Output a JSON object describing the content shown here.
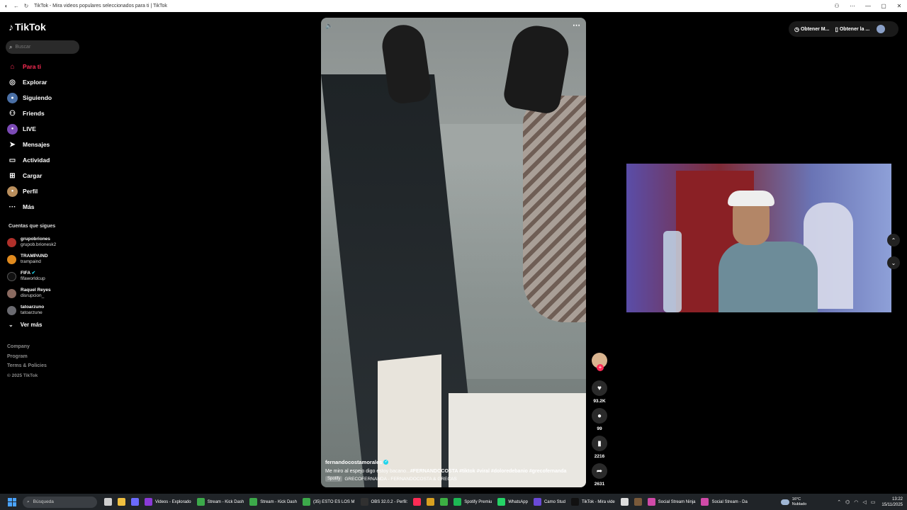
{
  "browser": {
    "tab_title": "TikTok - Mira videos populares seleccionados para ti | TikTok",
    "controls": [
      "minimize",
      "maximize",
      "close"
    ]
  },
  "sidebar": {
    "logo": "TikTok",
    "search_placeholder": "Buscar",
    "nav": [
      {
        "label": "Para ti",
        "icon": "home-icon",
        "active": true
      },
      {
        "label": "Explorar",
        "icon": "compass-icon"
      },
      {
        "label": "Siguiendo",
        "icon": "following-avatar-icon"
      },
      {
        "label": "Friends",
        "icon": "friends-icon"
      },
      {
        "label": "LIVE",
        "icon": "live-icon"
      },
      {
        "label": "Mensajes",
        "icon": "send-icon"
      },
      {
        "label": "Actividad",
        "icon": "inbox-icon"
      },
      {
        "label": "Cargar",
        "icon": "upload-icon"
      },
      {
        "label": "Perfil",
        "icon": "profile-avatar-icon"
      },
      {
        "label": "Más",
        "icon": "more-icon"
      }
    ],
    "following_header": "Cuentas que sigues",
    "following": [
      {
        "name": "grupobriones",
        "handle": "grupob.brionesk2",
        "color": "#b0302a"
      },
      {
        "name": "TRAMPAIND",
        "handle": "trampaind",
        "color": "#e08a1e"
      },
      {
        "name": "FIFA",
        "handle": "fifaworldcup",
        "color": "#111111",
        "verified": true
      },
      {
        "name": "Raquel Reyes",
        "handle": "disrupcion_",
        "color": "#8a6a60"
      },
      {
        "name": "tatoarzuno",
        "handle": "tatoarzune",
        "color": "#6a6a70"
      }
    ],
    "see_more": "Ver más",
    "footer": [
      "Company",
      "Program",
      "Terms & Policies"
    ],
    "copyright": "© 2025 TikTok"
  },
  "video": {
    "author": "fernandocostamorales",
    "description": "Me miro al espejo digo estoy bacano...",
    "tags": "#FERNANDOCOSTA  #tiktok  #viral  #doloredebanio  #grecofernanda",
    "music_badge": "Spotify",
    "music": "GRECOFERNANDA - FERNANDOCOSTA & GRECAS"
  },
  "actions": {
    "likes": "93.2K",
    "comments": "99",
    "saves": "2216",
    "shares": "2631"
  },
  "top_buttons": {
    "btn1": "Obtener M...",
    "btn2": "Obtener la ..."
  },
  "taskbar": {
    "search": "Búsqueda",
    "apps": [
      {
        "label": "",
        "color": "#cfcfcf"
      },
      {
        "label": "",
        "color": "#f0c040"
      },
      {
        "label": "",
        "color": "#6b6bff"
      },
      {
        "label": "Videos - Explorado",
        "color": "#8a3ad8"
      },
      {
        "label": "Stream - Kick Dash",
        "color": "#3ca94a"
      },
      {
        "label": "Stream - Kick Dash",
        "color": "#3ca94a"
      },
      {
        "label": "(35) ESTO ES LOS M",
        "color": "#3ca94a"
      },
      {
        "label": "OBS 32.0.2 - Perfil:",
        "color": "#303030"
      },
      {
        "label": "",
        "color": "#fe2c55"
      },
      {
        "label": "",
        "color": "#d8a020"
      },
      {
        "label": "",
        "color": "#3cb043"
      },
      {
        "label": "Spotify Premiu",
        "color": "#1db954"
      },
      {
        "label": "WhatsApp",
        "color": "#25d366"
      },
      {
        "label": "Camo Stud",
        "color": "#6a4ad8"
      },
      {
        "label": "TikTok - Mira vide",
        "color": "#111111"
      },
      {
        "label": "",
        "color": "#dddddd"
      },
      {
        "label": "",
        "color": "#7a5a3a"
      },
      {
        "label": "Social Stream Ninja",
        "color": "#d04aa8"
      },
      {
        "label": "Social Stream - Da",
        "color": "#d04aa8"
      }
    ],
    "weather_temp": "16°C",
    "weather_desc": "Nublado",
    "time": "13:22",
    "date": "15/11/2025"
  }
}
